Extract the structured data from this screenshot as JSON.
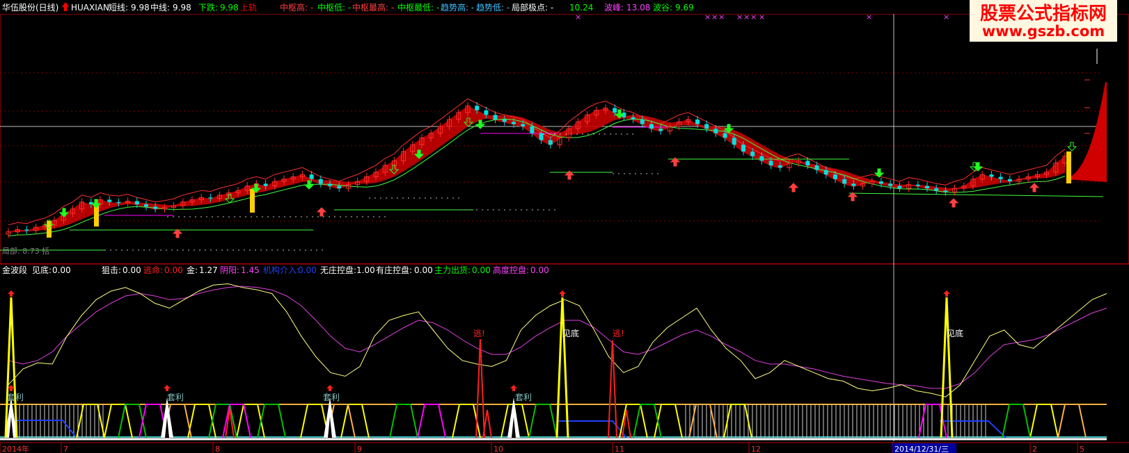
{
  "colors": {
    "bg": "#000000",
    "white": "#ffffff",
    "yellow": "#ffff00",
    "green": "#00ff00",
    "red": "#ff0000",
    "dkred": "#c00000",
    "magenta": "#ff00ff",
    "cyan": "#00e0e0",
    "blue": "#0000ff",
    "grid": "#800000",
    "tickred": "#ff3030",
    "lightyellow": "#ffff80",
    "orange": "#ffb040",
    "teal": "#40c0c0"
  },
  "header": {
    "stock": "华伍股份(日线)",
    "indicator": "HUAXIAN",
    "short_label": "短线:",
    "short_val": "9.98",
    "mid_label": "中线:",
    "mid_val": "9.98",
    "fall_label": "下跌:",
    "fall_val": "9.98",
    "rail_label": "上轨",
    "zs_high": "中枢高: -",
    "zs_low": "中枢低: -",
    "zs_max": "中枢最高: -",
    "zs_min": "中枢最低: -",
    "trend_high": "趋势高: -",
    "trend_low": "趋势低: -",
    "local_ext": "局部极点: -",
    "local_val": "10.24",
    "peak_label": "波峰:",
    "peak_val": "13.08",
    "trough_label": "波谷:",
    "trough_val": "9.69"
  },
  "watermark": {
    "line1": "股票公式指标网",
    "line2": "www.gszb.com"
  },
  "bottom_left_label": "局部: 8.73 括",
  "lower_panel": {
    "name": "金波段",
    "bottom_label": "见底:",
    "bottom_val": "0.00",
    "snipe_label": "狙击:",
    "snipe_val": "0.00",
    "escape_label": "逃命:",
    "escape_val": "0.00",
    "gold_label": "金:",
    "gold_val": "1.27",
    "yinyang_label": "阴阳:",
    "yinyang_val": "1.45",
    "inst_label": "机构介入:",
    "inst_val": "0.00",
    "nozhuang_label": "无庄控盘:",
    "nozhuang_val": "1.00",
    "youzhuang_label": "有庄控盘:",
    "youzhuang_val": "0.00",
    "main_label": "主力出货:",
    "main_val": "0.00",
    "high_label": "高度控盘:",
    "high_val": "0.00"
  },
  "annotations": {
    "taoli": "套利",
    "jiandi": "见底",
    "tao": "逃!"
  },
  "x_axis": {
    "ticks": [
      "2014年",
      "7",
      "8",
      "9",
      "10",
      "11",
      "12",
      "2014/12/31/三",
      "2",
      "5"
    ]
  },
  "chart_data": {
    "type": "candlestick",
    "title": "华伍股份(日线)",
    "xlabel": "",
    "ylabel": "",
    "ylim": [
      8.5,
      13.5
    ],
    "months": [
      "2014年",
      "7",
      "8",
      "9",
      "10",
      "11",
      "12",
      "2014/12/31/三",
      "2",
      "5"
    ],
    "series": [
      {
        "name": "短线",
        "last": 9.98
      },
      {
        "name": "中线",
        "last": 9.98
      },
      {
        "name": "下跌",
        "last": 9.98
      }
    ],
    "close_series": [
      9.05,
      9.1,
      9.08,
      9.15,
      9.2,
      9.3,
      9.45,
      9.55,
      9.7,
      9.65,
      9.75,
      9.7,
      9.68,
      9.72,
      9.65,
      9.6,
      9.55,
      9.58,
      9.62,
      9.7,
      9.75,
      9.8,
      9.78,
      9.85,
      9.9,
      9.95,
      10.05,
      10.1,
      10.05,
      10.15,
      10.2,
      10.25,
      10.3,
      10.2,
      10.1,
      10.05,
      10.0,
      10.08,
      10.15,
      10.25,
      10.35,
      10.5,
      10.6,
      10.8,
      10.95,
      11.1,
      11.2,
      11.35,
      11.5,
      11.65,
      11.8,
      11.7,
      11.6,
      11.5,
      11.45,
      11.4,
      11.35,
      11.2,
      11.05,
      10.95,
      11.1,
      11.3,
      11.45,
      11.6,
      11.7,
      11.75,
      11.65,
      11.55,
      11.5,
      11.4,
      11.3,
      11.25,
      11.35,
      11.45,
      11.5,
      11.4,
      11.3,
      11.2,
      11.1,
      10.95,
      10.8,
      10.7,
      10.6,
      10.5,
      10.45,
      10.55,
      10.6,
      10.5,
      10.4,
      10.3,
      10.2,
      10.1,
      10.05,
      10.1,
      10.15,
      10.1,
      10.05,
      10.0,
      10.08,
      10.05,
      10.0,
      9.95,
      9.92,
      10.0,
      10.05,
      10.2,
      10.3,
      10.25,
      10.2,
      10.15,
      10.2,
      10.25,
      10.3,
      10.35,
      10.55,
      10.7
    ],
    "osc_yellow": [
      0.15,
      0.28,
      0.33,
      0.32,
      0.55,
      0.72,
      0.85,
      0.92,
      0.95,
      0.9,
      0.82,
      0.78,
      0.85,
      0.92,
      0.97,
      0.98,
      0.95,
      0.93,
      0.9,
      0.75,
      0.55,
      0.38,
      0.25,
      0.22,
      0.3,
      0.55,
      0.68,
      0.72,
      0.75,
      0.6,
      0.45,
      0.35,
      0.32,
      0.3,
      0.35,
      0.6,
      0.72,
      0.8,
      0.85,
      0.8,
      0.6,
      0.38,
      0.25,
      0.3,
      0.5,
      0.62,
      0.7,
      0.78,
      0.6,
      0.45,
      0.35,
      0.2,
      0.25,
      0.35,
      0.3,
      0.25,
      0.2,
      0.18,
      0.12,
      0.1,
      0.12,
      0.15,
      0.1,
      0.08,
      0.05,
      0.15,
      0.35,
      0.55,
      0.6,
      0.48,
      0.45,
      0.55,
      0.65,
      0.75,
      0.85,
      0.9
    ],
    "osc_magenta": [
      0.35,
      0.32,
      0.35,
      0.42,
      0.55,
      0.65,
      0.75,
      0.82,
      0.88,
      0.9,
      0.88,
      0.85,
      0.86,
      0.9,
      0.93,
      0.95,
      0.96,
      0.95,
      0.93,
      0.88,
      0.8,
      0.68,
      0.55,
      0.45,
      0.42,
      0.48,
      0.55,
      0.62,
      0.68,
      0.66,
      0.6,
      0.52,
      0.45,
      0.4,
      0.4,
      0.46,
      0.55,
      0.62,
      0.68,
      0.68,
      0.62,
      0.52,
      0.42,
      0.4,
      0.44,
      0.5,
      0.56,
      0.6,
      0.55,
      0.48,
      0.42,
      0.35,
      0.32,
      0.32,
      0.3,
      0.28,
      0.25,
      0.22,
      0.2,
      0.18,
      0.16,
      0.15,
      0.14,
      0.12,
      0.12,
      0.16,
      0.25,
      0.38,
      0.48,
      0.5,
      0.52,
      0.56,
      0.62,
      0.68,
      0.74,
      0.78
    ]
  }
}
